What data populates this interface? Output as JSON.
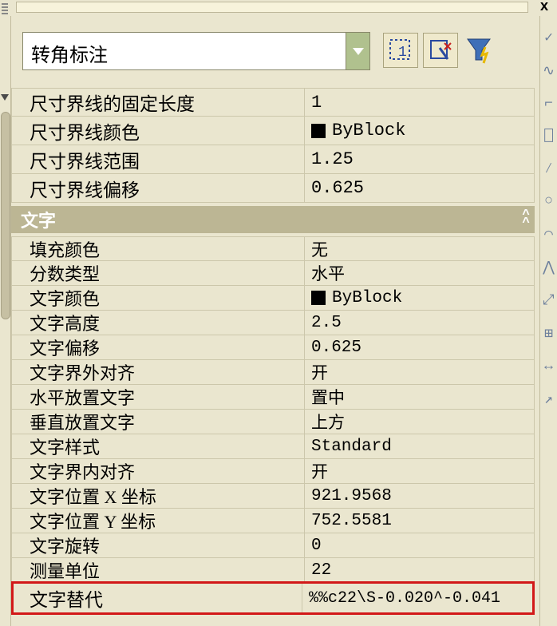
{
  "titlebar": {
    "close_glyph": "x"
  },
  "toolbar": {
    "dropdown_text": "转角标注",
    "btn1_label": "1",
    "btn2_glyph": "↖",
    "btn3_glyph": "⚡"
  },
  "group1": {
    "rows": [
      {
        "label": "尺寸界线的固定长度",
        "value": "1"
      },
      {
        "label": "尺寸界线颜色",
        "value": "ByBlock",
        "swatch": true
      },
      {
        "label": "尺寸界线范围",
        "value": "1.25"
      },
      {
        "label": "尺寸界线偏移",
        "value": "0.625"
      }
    ]
  },
  "group2": {
    "title": "文字",
    "chevron": "︿\n︿",
    "rows": [
      {
        "label": "填充颜色",
        "value": "无"
      },
      {
        "label": "分数类型",
        "value": "水平"
      },
      {
        "label": "文字颜色",
        "value": "ByBlock",
        "swatch": true
      },
      {
        "label": "文字高度",
        "value": "2.5"
      },
      {
        "label": "文字偏移",
        "value": "0.625"
      },
      {
        "label": "文字界外对齐",
        "value": "开"
      },
      {
        "label": "水平放置文字",
        "value": "置中"
      },
      {
        "label": "垂直放置文字",
        "value": "上方"
      },
      {
        "label": "文字样式",
        "value": "Standard"
      },
      {
        "label": "文字界内对齐",
        "value": "开"
      },
      {
        "label": "文字位置 X 坐标",
        "value": "921.9568"
      },
      {
        "label": "文字位置 Y 坐标",
        "value": "752.5581"
      },
      {
        "label": "文字旋转",
        "value": "0"
      },
      {
        "label": "测量单位",
        "value": "22"
      }
    ]
  },
  "highlight": {
    "label": "文字替代",
    "value": "%%c22\\S-0.020^-0.041"
  }
}
